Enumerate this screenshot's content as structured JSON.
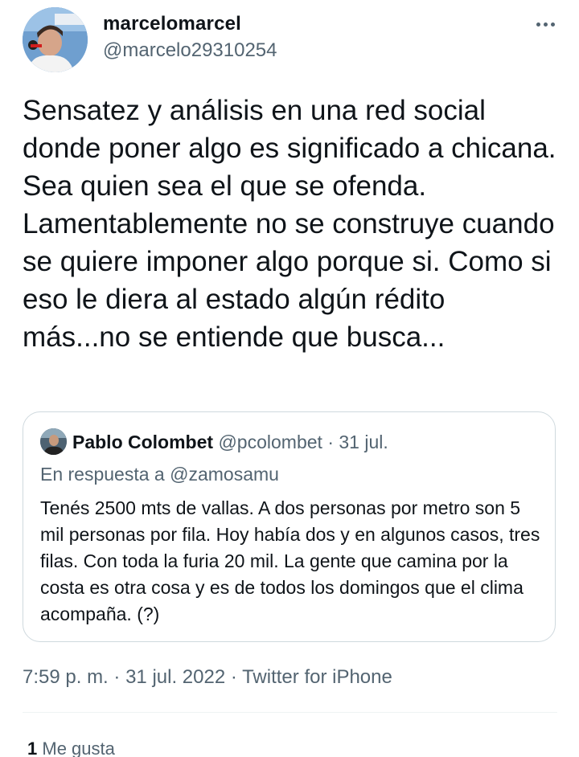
{
  "author": {
    "name": "marcelomarcel",
    "handle": "@marcelo29310254"
  },
  "tweet": {
    "text": "Sensatez y análisis en una red social donde poner algo es significado a chicana. Sea quien sea el que se ofenda. Lamentablemente no se construye cuando se quiere imponer algo porque si. Como si eso le diera al estado algún rédito más...no se entiende que busca..."
  },
  "quoted_tweet": {
    "name": "Pablo Colombet",
    "handle": "@pcolombet",
    "separator": "·",
    "date": "31 jul.",
    "reply_to": "En respuesta a @zamosamu",
    "text": "Tenés 2500 mts de vallas. A dos personas por metro son 5 mil personas por fila. Hoy había dos y en algunos casos, tres filas. Con toda la furia 20 mil. La gente que camina por la costa es otra cosa y es de todos los domingos que el clima acompaña. (?)"
  },
  "meta": {
    "time": "7:59 p. m.",
    "separator": "·",
    "date": "31 jul. 2022",
    "source": "Twitter for iPhone"
  },
  "stats": {
    "likes_count": "1",
    "likes_label": "Me gusta"
  },
  "colors": {
    "text": "#0f1419",
    "secondary": "#536471",
    "border": "#cfd9de"
  }
}
